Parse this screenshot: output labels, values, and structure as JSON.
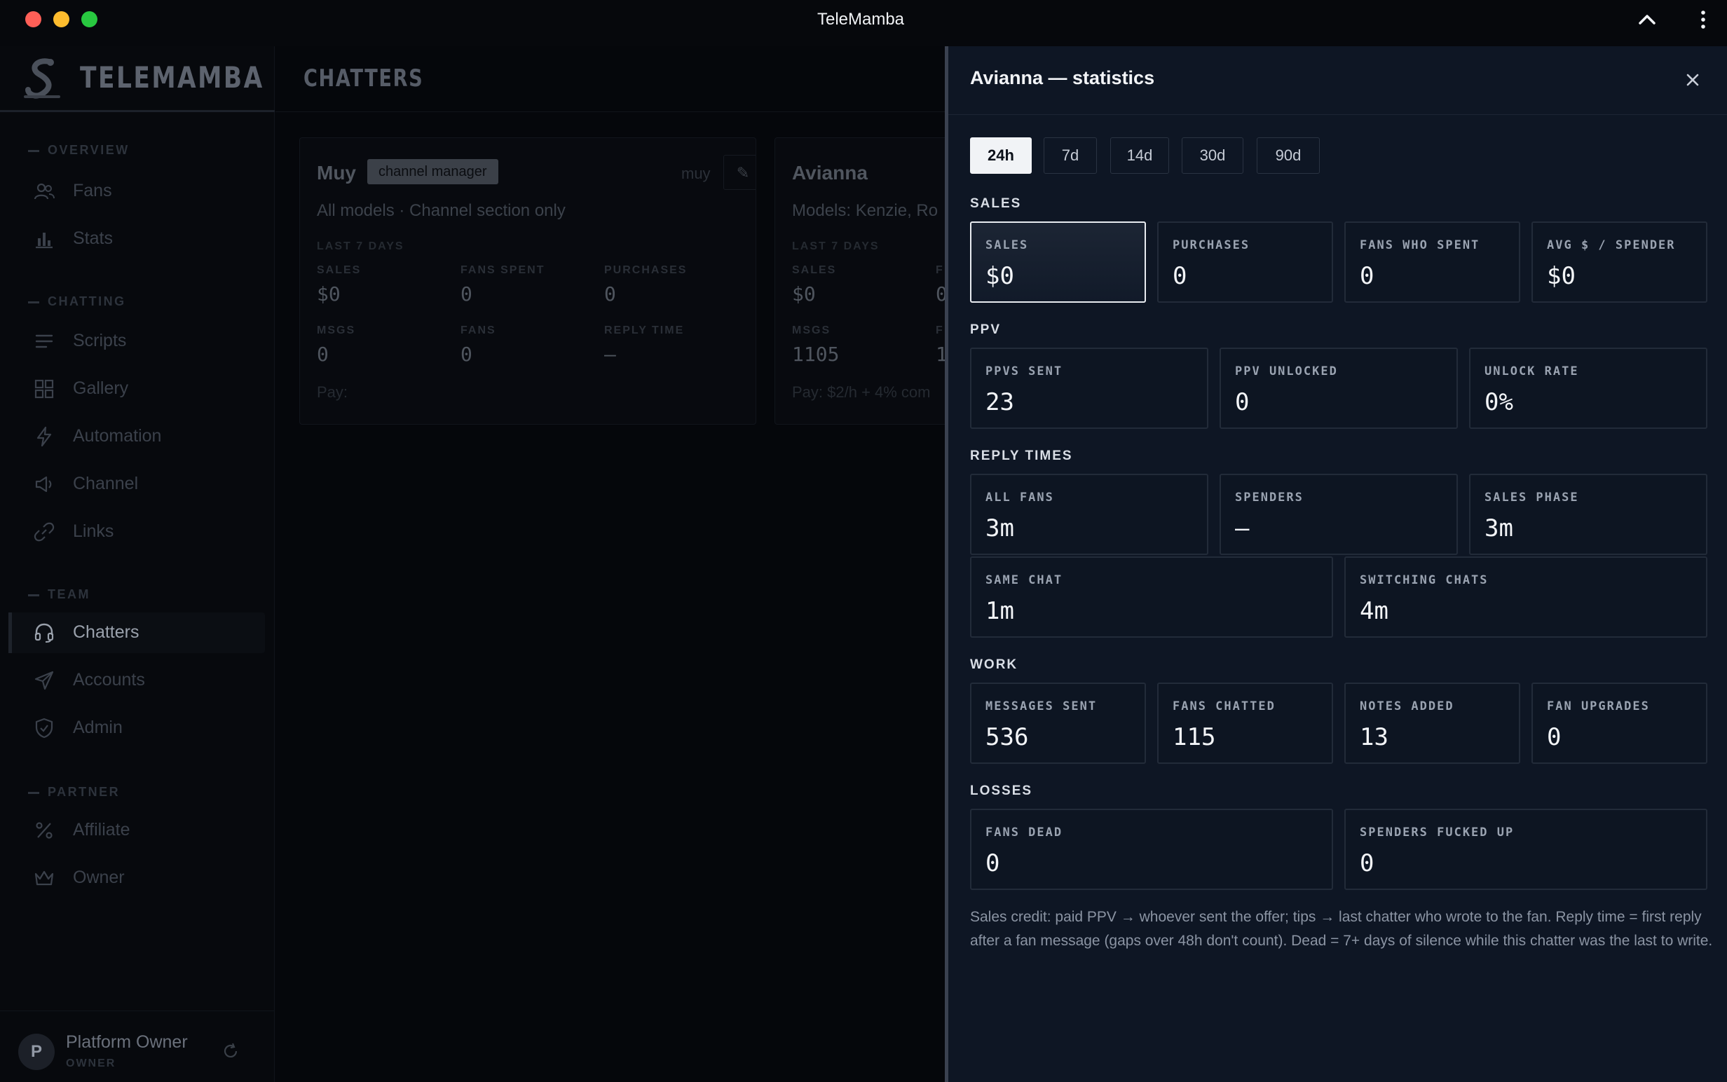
{
  "window": {
    "title": "TeleMamba"
  },
  "sidebar": {
    "brand": "TELEMAMBA",
    "sections": {
      "overview": "OVERVIEW",
      "chatting": "CHATTING",
      "team": "TEAM",
      "partner": "PARTNER"
    },
    "items": {
      "fans": "Fans",
      "stats": "Stats",
      "scripts": "Scripts",
      "gallery": "Gallery",
      "automation": "Automation",
      "channel": "Channel",
      "links": "Links",
      "chatters": "Chatters",
      "accounts": "Accounts",
      "admin": "Admin",
      "affiliate": "Affiliate",
      "owner": "Owner"
    },
    "active_item": "Chatters",
    "user": {
      "initial": "P",
      "name": "Platform Owner",
      "role": "OWNER"
    }
  },
  "main": {
    "title": "CHATTERS",
    "cards": [
      {
        "name": "Muy",
        "badge": "channel manager",
        "handle": "muy",
        "edit_icon": "✎",
        "subtitle": "All models · Channel section only",
        "period": "LAST 7 DAYS",
        "stats": {
          "sales_label": "SALES",
          "sales": "$0",
          "fans_spent_label": "FANS SPENT",
          "fans_spent": "0",
          "purchases_label": "PURCHASES",
          "purchases": "0",
          "msgs_label": "MSGS",
          "msgs": "0",
          "fans_label": "FANS",
          "fans": "0",
          "reply_time_label": "REPLY TIME",
          "reply_time": "—"
        },
        "pay": "Pay:"
      },
      {
        "name": "Avianna",
        "subtitle": "Models: Kenzie, Ro",
        "period": "LAST 7 DAYS",
        "stats": {
          "sales_label": "SALES",
          "sales": "$0",
          "fans_spent_label": "F",
          "fans_spent": "0",
          "msgs_label": "MSGS",
          "msgs": "1105",
          "fans_label": "F",
          "fans": "1"
        },
        "pay": "Pay: $2/h + 4% com"
      }
    ]
  },
  "drawer": {
    "title": "Avianna — statistics",
    "ranges": [
      "24h",
      "7d",
      "14d",
      "30d",
      "90d"
    ],
    "active_range": "24h",
    "groups": {
      "sales": {
        "label": "SALES",
        "stats": [
          {
            "label": "SALES",
            "value": "$0"
          },
          {
            "label": "PURCHASES",
            "value": "0"
          },
          {
            "label": "FANS WHO SPENT",
            "value": "0"
          },
          {
            "label": "AVG $ / SPENDER",
            "value": "$0"
          }
        ]
      },
      "ppv": {
        "label": "PPV",
        "stats": [
          {
            "label": "PPVS SENT",
            "value": "23"
          },
          {
            "label": "PPV UNLOCKED",
            "value": "0"
          },
          {
            "label": "UNLOCK RATE",
            "value": "0%"
          }
        ]
      },
      "reply_times": {
        "label": "REPLY TIMES",
        "stats": [
          {
            "label": "ALL FANS",
            "value": "3m"
          },
          {
            "label": "SPENDERS",
            "value": "—"
          },
          {
            "label": "SALES PHASE",
            "value": "3m"
          },
          {
            "label": "SAME CHAT",
            "value": "1m"
          },
          {
            "label": "SWITCHING CHATS",
            "value": "4m"
          }
        ]
      },
      "work": {
        "label": "WORK",
        "stats": [
          {
            "label": "MESSAGES SENT",
            "value": "536"
          },
          {
            "label": "FANS CHATTED",
            "value": "115"
          },
          {
            "label": "NOTES ADDED",
            "value": "13"
          },
          {
            "label": "FAN UPGRADES",
            "value": "0"
          }
        ]
      },
      "losses": {
        "label": "LOSSES",
        "stats": [
          {
            "label": "FANS DEAD",
            "value": "0"
          },
          {
            "label": "SPENDERS FUCKED UP",
            "value": "0"
          }
        ]
      }
    },
    "footnote": "Sales credit: paid PPV → whoever sent the offer; tips → last chatter who wrote to the fan. Reply time = first reply after a fan message (gaps over 48h don't count). Dead = 7+ days of silence while this chatter was the last to write."
  }
}
